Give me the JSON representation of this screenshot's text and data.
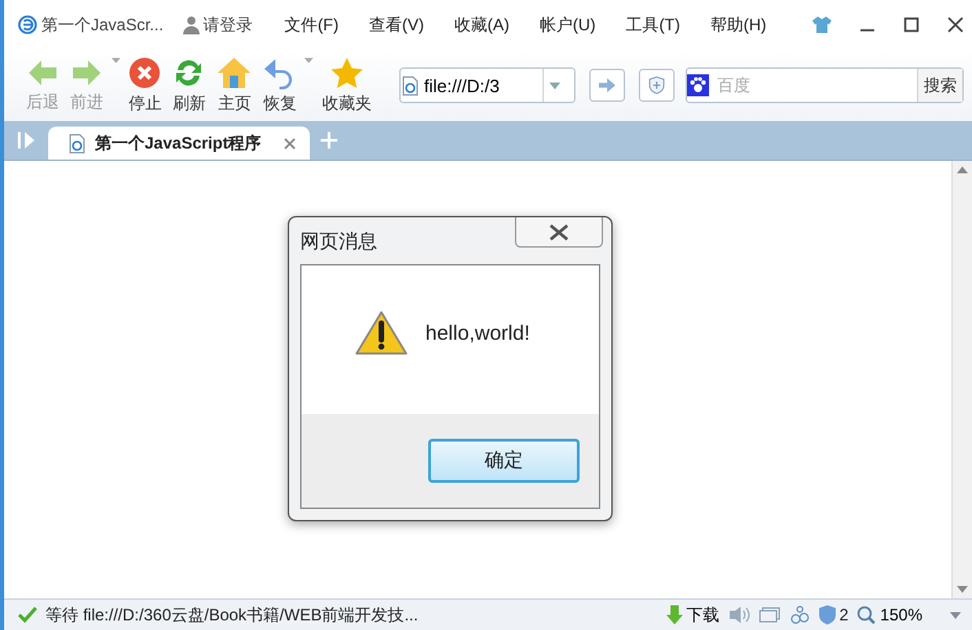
{
  "window": {
    "title": "第一个JavaScr...",
    "login": "请登录"
  },
  "menu": [
    {
      "label": "文件(F)"
    },
    {
      "label": "查看(V)"
    },
    {
      "label": "收藏(A)"
    },
    {
      "label": "帐户(U)"
    },
    {
      "label": "工具(T)"
    },
    {
      "label": "帮助(H)"
    }
  ],
  "toolbar": [
    {
      "kind": "back",
      "label": "后退",
      "disabled": true
    },
    {
      "kind": "forward",
      "label": "前进",
      "disabled": true
    },
    {
      "kind": "stop",
      "label": "停止",
      "disabled": false
    },
    {
      "kind": "refresh",
      "label": "刷新",
      "disabled": false
    },
    {
      "kind": "home",
      "label": "主页",
      "disabled": false
    },
    {
      "kind": "restore",
      "label": "恢复",
      "disabled": false
    },
    {
      "kind": "favorites",
      "label": "收藏夹",
      "disabled": false
    }
  ],
  "address": {
    "value": "file:///D:/3"
  },
  "search": {
    "placeholder": "百度",
    "button": "搜索"
  },
  "tabs": [
    {
      "label": "第一个JavaScript程序",
      "selected": true
    }
  ],
  "dialog": {
    "title": "网页消息",
    "message": "hello,world!",
    "button": "确定"
  },
  "status": {
    "text": "等待 file:///D:/360云盘/Book书籍/WEB前端开发技...",
    "download": "下载",
    "count": "2",
    "zoom": "150%"
  }
}
